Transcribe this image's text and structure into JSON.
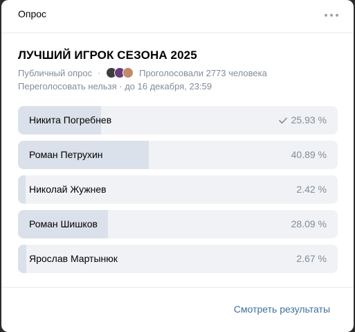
{
  "header": {
    "title": "Опрос"
  },
  "poll": {
    "title": "ЛУЧШИЙ ИГРОК СЕЗОНА 2025",
    "type_label": "Публичный опрос",
    "separator": "·",
    "voted_text": "Проголосовали 2773 человека",
    "revote_text": "Переголосовать нельзя · до 16 декабря, 23:59",
    "options": [
      {
        "label": "Никита Погребнев",
        "percent": "25.93 %",
        "value": 25.93,
        "checked": true
      },
      {
        "label": "Роман Петрухин",
        "percent": "40.89 %",
        "value": 40.89,
        "checked": false
      },
      {
        "label": "Николай Жужнев",
        "percent": "2.42 %",
        "value": 2.42,
        "checked": false
      },
      {
        "label": "Роман Шишков",
        "percent": "28.09 %",
        "value": 28.09,
        "checked": false
      },
      {
        "label": "Ярослав Мартынюк",
        "percent": "2.67 %",
        "value": 2.67,
        "checked": false
      }
    ]
  },
  "footer": {
    "results_label": "Смотреть результаты"
  },
  "colors": {
    "accent": "#2a5885",
    "fill": "#dbe1ea",
    "track": "#f0f2f5",
    "muted": "#818c99"
  }
}
